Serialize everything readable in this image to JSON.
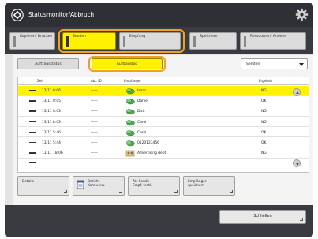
{
  "window": {
    "title": "Statusmonitor/Abbruch"
  },
  "tabs": [
    {
      "label": "Kopieren/ Drucken"
    },
    {
      "label": "Senden"
    },
    {
      "label": "Empfang"
    },
    {
      "label": "Speichern"
    },
    {
      "label": "Ressourcen/ Andere"
    }
  ],
  "subtabs": {
    "job_status": "Auftragsstatus",
    "job_log": "Auftragslog"
  },
  "filter": {
    "selected": "Senden"
  },
  "table": {
    "headers": {
      "time": "Zeit",
      "job_no": "Abt. ID",
      "recipient": "Empfänger",
      "result": "Ergebnis"
    },
    "rows": [
      {
        "time": "13/11 8:06",
        "id": "——",
        "recipient": "Isaac",
        "result": "NG",
        "type": "contact"
      },
      {
        "time": "13/11 8:05",
        "id": "——",
        "recipient": "Daniel",
        "result": "OK",
        "type": "contact"
      },
      {
        "time": "13/11 8:03",
        "id": "——",
        "recipient": "Dick",
        "result": "NG",
        "type": "contact"
      },
      {
        "time": "13/11 8:03",
        "id": "——",
        "recipient": "Carol",
        "result": "NG",
        "type": "contact"
      },
      {
        "time": "13/11 5:46",
        "id": "——",
        "recipient": "Carol",
        "result": "OK",
        "type": "contact"
      },
      {
        "time": "13/11 5:44",
        "id": "——",
        "recipient": "0120123456",
        "result": "OK",
        "type": "contact"
      },
      {
        "time": "11/11 18:06",
        "id": "——",
        "recipient": "Advertising dept",
        "result": "NG",
        "type": "group"
      }
    ]
  },
  "actions": {
    "details": "Details",
    "report_l1": "Bericht",
    "report_l2": "Kom.verw.",
    "register_l1": "Als Sende-",
    "register_l2": "Empf. festl.",
    "save_l1": "Empfänger",
    "save_l2": "speichern"
  },
  "footer": {
    "close": "Schließen"
  },
  "colors": {
    "accent": "#fff200",
    "highlight_ring": "#f3a020",
    "title_bg": "#2f3035"
  }
}
